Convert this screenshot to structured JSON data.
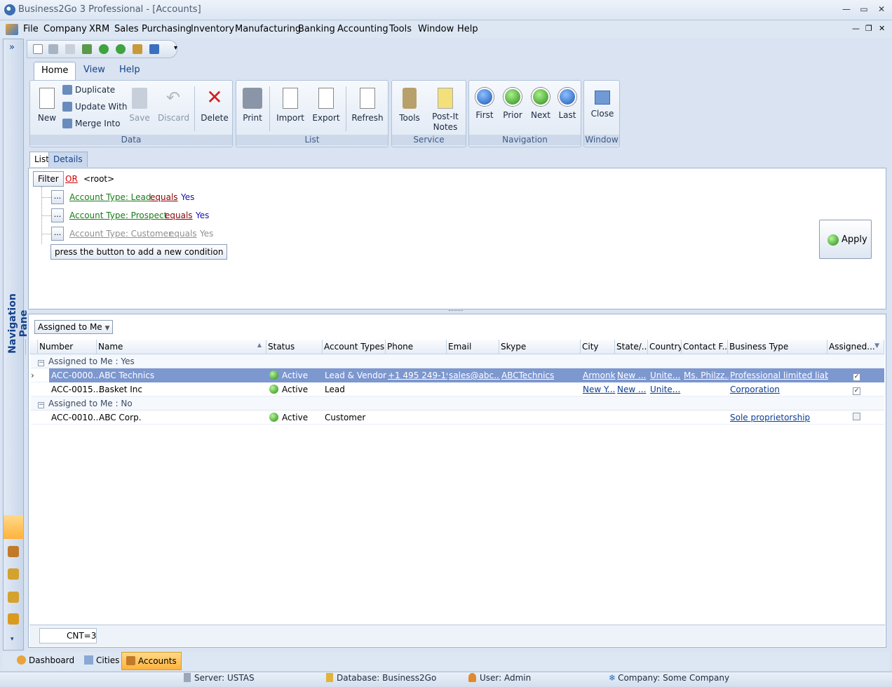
{
  "app": {
    "title": "Business2Go 3 Professional - [Accounts]"
  },
  "menu": {
    "items": [
      {
        "label": "File"
      },
      {
        "label": "Company"
      },
      {
        "label": "XRM"
      },
      {
        "label": "Sales"
      },
      {
        "label": "Purchasing"
      },
      {
        "label": "Inventory"
      },
      {
        "label": "Manufacturing"
      },
      {
        "label": "Banking"
      },
      {
        "label": "Accounting"
      },
      {
        "label": "Tools"
      },
      {
        "label": "Window"
      },
      {
        "label": "Help"
      }
    ]
  },
  "ribbon": {
    "tabs": [
      "Home",
      "View",
      "Help"
    ],
    "data": {
      "group": "Data",
      "new": "New",
      "duplicate": "Duplicate",
      "update_with": "Update With",
      "merge_into": "Merge Into",
      "save": "Save",
      "discard": "Discard",
      "delete": "Delete"
    },
    "list": {
      "group": "List",
      "print": "Print",
      "import": "Import",
      "export": "Export",
      "refresh": "Refresh"
    },
    "service": {
      "group": "Service",
      "tools": "Tools",
      "postit_1": "Post-It",
      "postit_2": "Notes"
    },
    "navigation": {
      "group": "Navigation",
      "first": "First",
      "prior": "Prior",
      "next": "Next",
      "last": "Last"
    },
    "window": {
      "group": "Window",
      "close": "Close"
    }
  },
  "doc_tabs": {
    "list": "List",
    "details": "Details"
  },
  "navpane": {
    "label": "Navigation Pane"
  },
  "filter": {
    "button": "Filter",
    "op": "OR",
    "root": "<root>",
    "conditions": [
      {
        "field": "Account Type: Lead",
        "op": "equals",
        "value": "Yes"
      },
      {
        "field": "Account Type: Prospect",
        "op": "equals",
        "value": "Yes"
      },
      {
        "field": "Account Type: Customer",
        "op": "equals",
        "value": "Yes"
      }
    ],
    "add_hint": "press the button to add a new condition",
    "dots": "...",
    "apply": "Apply"
  },
  "grid": {
    "group_by": "Assigned to Me",
    "columns": [
      "Number",
      "Name",
      "Status",
      "Account Types",
      "Phone",
      "Email",
      "Skype",
      "City",
      "State/...",
      "Country",
      "Contact F...",
      "Business Type",
      "Assigned..."
    ],
    "groups": [
      {
        "label": "Assigned to Me : Yes",
        "rows": [
          {
            "number": "ACC-0000...",
            "name": "ABC Technics",
            "status": "Active",
            "types": "Lead & Vendor",
            "phone": "+1 495 249-19...",
            "email": "sales@abc....",
            "skype": "ABCTechnics",
            "city": "Armonk",
            "state": "New ...",
            "country": "Unite...",
            "contact": "Ms. Philzz...",
            "btype": "Professional limited liab...",
            "assigned": true
          },
          {
            "number": "ACC-0015...",
            "name": "Basket Inc",
            "status": "Active",
            "types": "Lead",
            "phone": "",
            "email": "",
            "skype": "",
            "city": "New Y...",
            "state": "New ...",
            "country": "Unite...",
            "contact": "",
            "btype": "Corporation",
            "assigned": true
          }
        ]
      },
      {
        "label": "Assigned to Me : No",
        "rows": [
          {
            "number": "ACC-0010...",
            "name": "ABC Corp.",
            "status": "Active",
            "types": "Customer",
            "phone": "",
            "email": "",
            "skype": "",
            "city": "",
            "state": "",
            "country": "",
            "contact": "",
            "btype": "Sole proprietorship",
            "assigned": false
          }
        ]
      }
    ],
    "footer": "CNT=3"
  },
  "bottom_tabs": [
    "Dashboard",
    "Cities",
    "Accounts"
  ],
  "status": {
    "server": "Server: USTAS",
    "database": "Database: Business2Go",
    "user": "User: Admin",
    "company": "Company: Some Company"
  }
}
